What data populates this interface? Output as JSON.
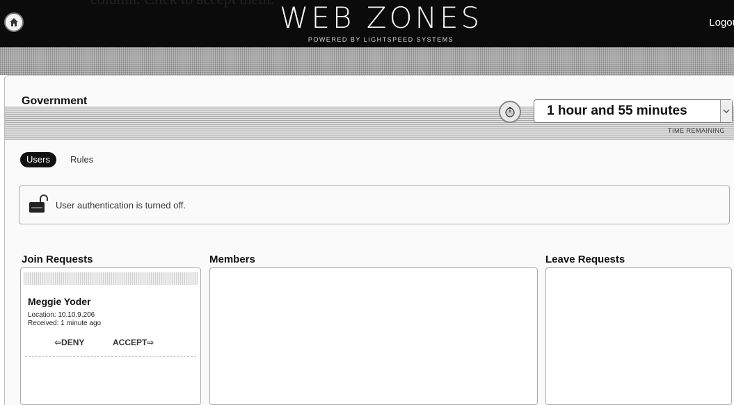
{
  "caption": "column. Click to accept them.",
  "topbar": {
    "brand_title": "WEB ZONES",
    "brand_subtitle": "POWERED BY LIGHTSPEED SYSTEMS",
    "logout_label": "Logou",
    "background": "#0b0b0b"
  },
  "zone": {
    "name": "Government",
    "time_value": "1 hour and 55 minutes",
    "time_label": "TIME REMAINING"
  },
  "tabs": [
    {
      "label": "Users",
      "active": true
    },
    {
      "label": "Rules",
      "active": false
    }
  ],
  "notice": {
    "text": "User authentication is turned off."
  },
  "columns": {
    "join": {
      "title": "Join Requests",
      "requests": [
        {
          "name": "Meggie Yoder",
          "location": "Location: 10.10.9.206",
          "received": "Received: 1 minute ago",
          "deny_label": "⇦DENY",
          "accept_label": "ACCEPT⇨"
        }
      ]
    },
    "members": {
      "title": "Members"
    },
    "leave": {
      "title": "Leave Requests"
    }
  },
  "icons": {
    "home": "home-icon",
    "timer": "stopwatch-icon",
    "lock": "unlocked-lock-icon"
  }
}
